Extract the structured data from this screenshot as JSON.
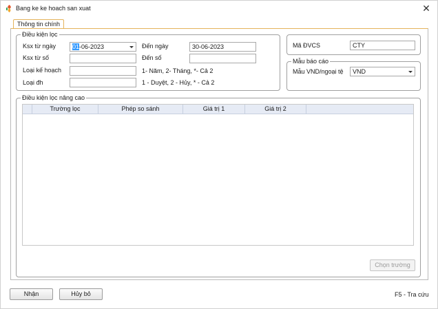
{
  "window": {
    "title": "Bang ke ke hoach san xuat"
  },
  "tabs": [
    {
      "label": "Thông tin chính"
    }
  ],
  "filter_group": {
    "legend": "Điều kiện lọc",
    "from_date": {
      "label": "Ksx từ ngày",
      "value_highlight": "01",
      "value_rest": "-06-2023"
    },
    "to_date": {
      "label": "Đến ngày",
      "value": "30-06-2023"
    },
    "from_number": {
      "label": "Ksx từ số",
      "value": ""
    },
    "to_number": {
      "label": "Đến số",
      "value": ""
    },
    "plan_type": {
      "label": "Loại kế hoạch",
      "value": "",
      "hint": "1- Năm, 2- Tháng, *- Cả 2"
    },
    "order_type": {
      "label": "Loại đh",
      "value": "",
      "hint": "1 - Duyệt, 2 - Hủy, * - Cả 2"
    }
  },
  "unit_group": {
    "label": "Mã ĐVCS",
    "value": "CTY"
  },
  "report_group": {
    "legend": "Mẫu báo cáo",
    "label": "Mẫu VND/ngoại tệ",
    "value": "VND"
  },
  "advanced_group": {
    "legend": "Điều kiện lọc nâng cao",
    "columns": [
      "Trường lọc",
      "Phép so sánh",
      "Giá trị 1",
      "Giá trị 2"
    ],
    "choose_field_button": "Chọn trường"
  },
  "footer": {
    "ok_button": "Nhận",
    "cancel_button": "Hủy bỏ",
    "lookup_hint": "F5 - Tra cứu"
  }
}
